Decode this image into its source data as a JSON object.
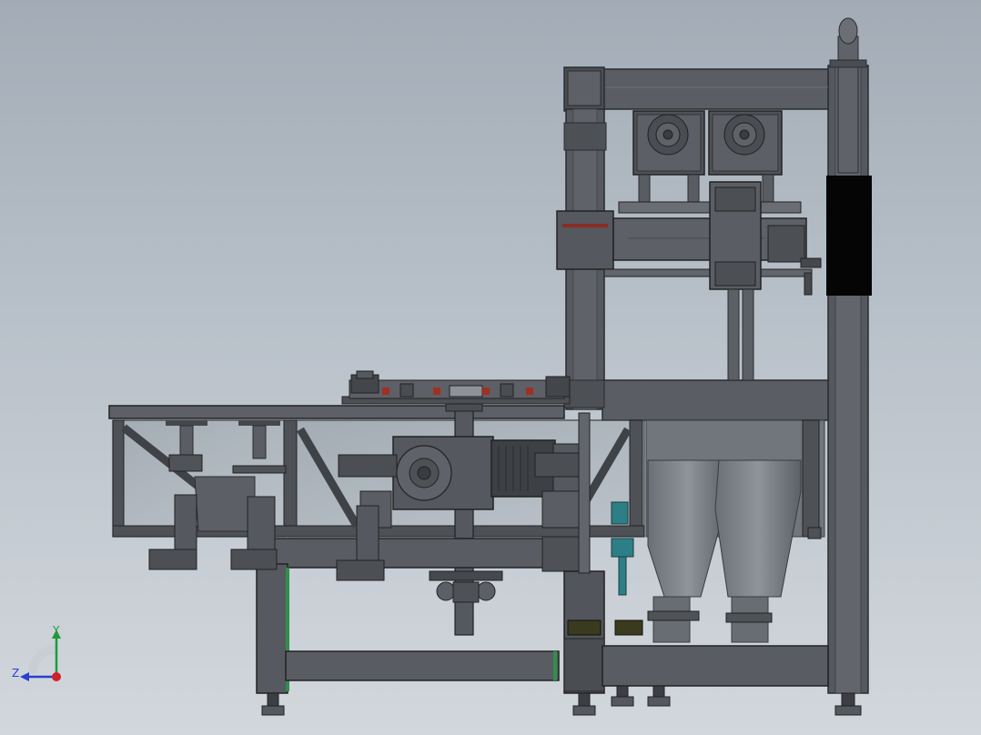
{
  "view": {
    "background_top": "#a3acb6",
    "background_bottom": "#d2d7dc"
  },
  "triad": {
    "y_label": "Y",
    "z_label": "Z",
    "y_color": "#1e9a3a",
    "z_color": "#2b3fd0",
    "x_color": "#d0202a"
  },
  "colors": {
    "frame": "#4f5258",
    "frame_dark": "#2e3034",
    "frame_light": "#6d7076",
    "glass": "#9aa3aa",
    "teal": "#2d7f86",
    "green": "#2f8f4a",
    "black_band": "#050505",
    "olive": "#3a3a1e"
  }
}
